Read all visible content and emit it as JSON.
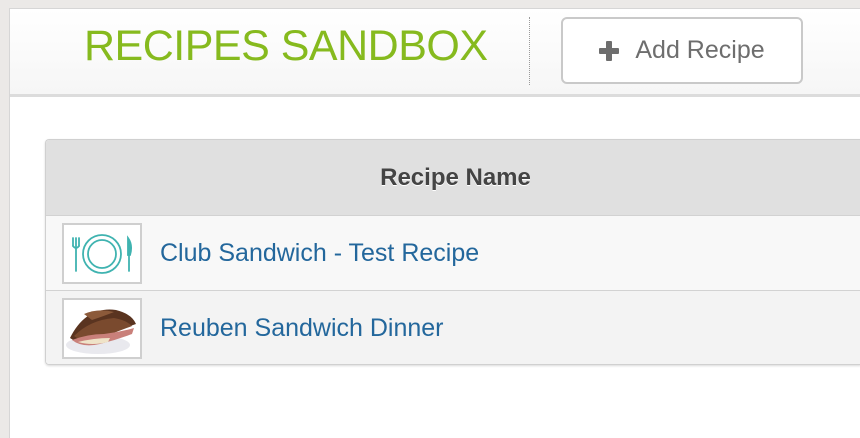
{
  "header": {
    "title": "RECIPES SANDBOX",
    "add_button_label": "Add Recipe",
    "add_button_icon": "plus-icon"
  },
  "table": {
    "column_header": "Recipe Name",
    "rows": [
      {
        "name": "Club Sandwich - Test Recipe",
        "thumbnail": "plate-cutlery-icon"
      },
      {
        "name": "Reuben Sandwich Dinner",
        "thumbnail": "reuben-sandwich-photo"
      }
    ]
  },
  "colors": {
    "title": "#86ba1e",
    "link": "#23679c",
    "placeholder_icon": "#3fb3b0"
  }
}
